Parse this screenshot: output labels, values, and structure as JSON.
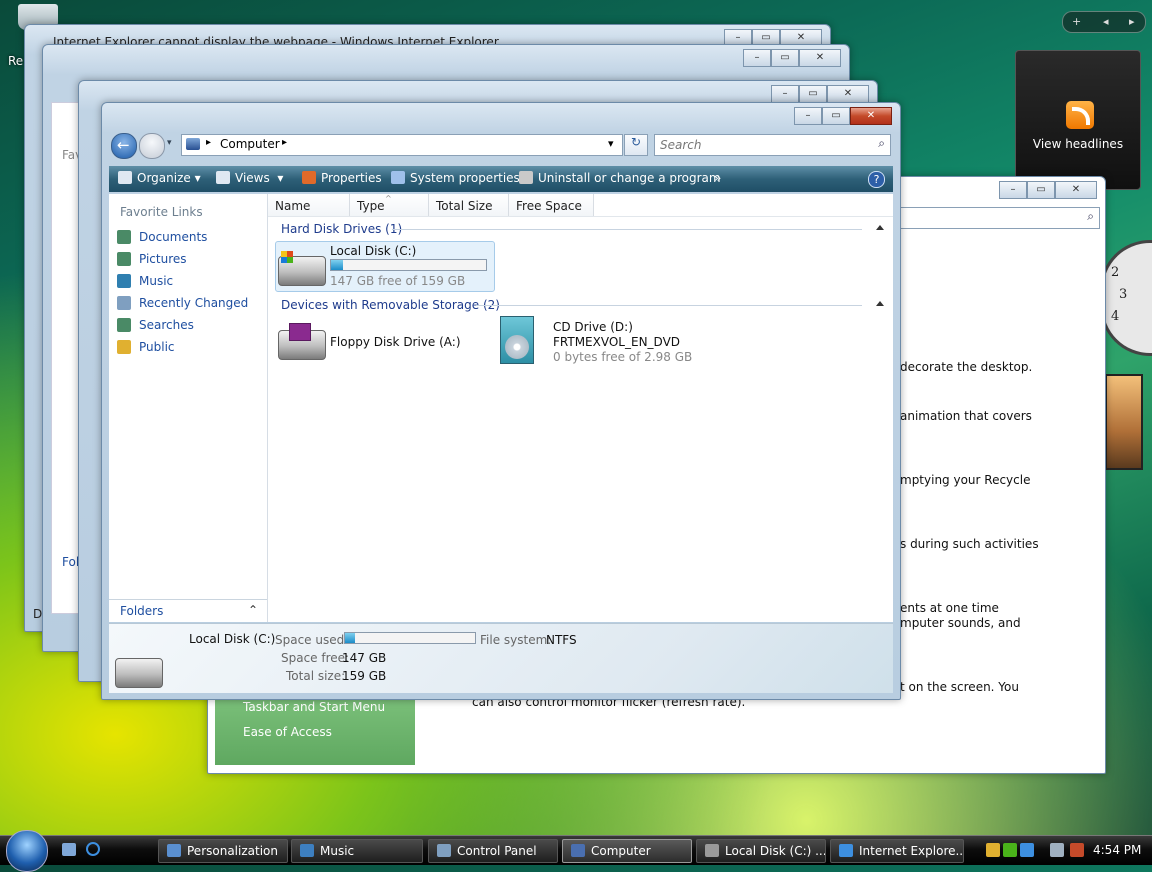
{
  "desktop": {
    "recycle_label": "Re"
  },
  "sidebar": {
    "toolbar": {
      "add": "+",
      "prev": "◂",
      "next": "▸"
    },
    "feed_gadget": {
      "label": "View headlines"
    },
    "clock_numbers": [
      "2",
      "3",
      "4"
    ]
  },
  "bg_windows": {
    "ie_title": "Internet Explorer cannot display the webpage - Windows Internet Explorer",
    "left_stub": {
      "favorites": "Fav",
      "folders": "Fol",
      "d": "D"
    }
  },
  "personalization_window": {
    "lines": [
      "decorate the desktop.",
      "animation that covers",
      "mptying your Recycle",
      "s during such activities",
      "ents at one time",
      "mputer sounds, and",
      "t on the screen. You",
      "can also control monitor flicker (refresh rate)."
    ],
    "green_pane": [
      "Taskbar and Start Menu",
      "Ease of Access"
    ]
  },
  "main_window": {
    "title_buttons": {
      "minimize": "–",
      "maximize": "▭",
      "close": "✕"
    },
    "address": {
      "path": "Computer",
      "arrow": "▸",
      "dropdown": "▾",
      "refresh": "↻"
    },
    "search": {
      "placeholder": "Search",
      "icon": "⌕"
    },
    "toolbar": {
      "organize": "Organize",
      "views": "Views",
      "properties": "Properties",
      "system_properties": "System properties",
      "uninstall": "Uninstall or change a program",
      "more": "»",
      "help": "?"
    },
    "nav": {
      "favorite_links_title": "Favorite Links",
      "items": [
        {
          "label": "Documents",
          "icon": "documents-icon",
          "color": "#4a8a66"
        },
        {
          "label": "Pictures",
          "icon": "pictures-icon",
          "color": "#4a8a66"
        },
        {
          "label": "Music",
          "icon": "music-icon",
          "color": "#2f7fb0"
        },
        {
          "label": "Recently Changed",
          "icon": "recently-changed-icon",
          "color": "#7f9fc0"
        },
        {
          "label": "Searches",
          "icon": "searches-icon",
          "color": "#4a8a66"
        },
        {
          "label": "Public",
          "icon": "public-folder-icon",
          "color": "#e0b030"
        }
      ],
      "folders_label": "Folders",
      "folders_toggle": "⌃"
    },
    "columns": [
      "Name",
      "Type",
      "Total Size",
      "Free Space"
    ],
    "groups": {
      "hard_disks": "Hard Disk Drives (1)",
      "removable": "Devices with Removable Storage (2)"
    },
    "drives": {
      "local": {
        "name": "Local Disk (C:)",
        "free": "147 GB free of 159 GB",
        "used_fraction": 0.075
      },
      "floppy": {
        "name": "Floppy Disk Drive (A:)"
      },
      "cd": {
        "name": "CD Drive (D:)",
        "label": "FRTMEXVOL_EN_DVD",
        "free": "0 bytes free of 2.98 GB"
      }
    },
    "details": {
      "name": "Local Disk (C:)",
      "space_used_label": "Space used:",
      "space_free_label": "Space free:",
      "space_free": "147 GB",
      "total_size_label": "Total size:",
      "total_size": "159 GB",
      "fs_label": "File system:",
      "fs_value": "NTFS",
      "used_fraction": 0.075
    }
  },
  "taskbar": {
    "buttons": [
      {
        "label": "Personalization",
        "color": "#5a8fd0"
      },
      {
        "label": "Music",
        "color": "#3d7fc0"
      },
      {
        "label": "Control Panel",
        "color": "#7f9fc0"
      },
      {
        "label": "Computer",
        "color": "#4a6fb0"
      },
      {
        "label": "Local Disk (C:) ...",
        "color": "#9a9a9a"
      },
      {
        "label": "Internet Explore...",
        "color": "#3d8fe0"
      }
    ],
    "time": "4:54 PM"
  }
}
